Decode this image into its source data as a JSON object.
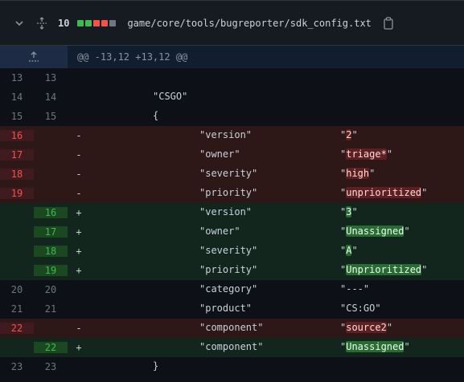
{
  "file": {
    "changes": "10",
    "path": "game/core/tools/bugreporter/sdk_config.txt",
    "diffstat_colors": [
      "#3fb950",
      "#3fb950",
      "#f85149",
      "#f85149",
      "#6e7681"
    ]
  },
  "hunk": {
    "header": "@@ -13,12 +13,12 @@"
  },
  "lines": [
    {
      "type": "ctx",
      "old": "13",
      "new": "13",
      "marker": "",
      "key": "",
      "val": "",
      "plain": ""
    },
    {
      "type": "ctx",
      "old": "14",
      "new": "14",
      "marker": "",
      "key": "",
      "val": "",
      "plain": "\"CSGO\""
    },
    {
      "type": "ctx",
      "old": "15",
      "new": "15",
      "marker": "",
      "key": "",
      "val": "",
      "plain": "{"
    },
    {
      "type": "del",
      "old": "16",
      "new": "",
      "marker": "-",
      "key": "\"version\"",
      "val": "\"2\""
    },
    {
      "type": "del",
      "old": "17",
      "new": "",
      "marker": "-",
      "key": "\"owner\"",
      "val": "\"triage*\""
    },
    {
      "type": "del",
      "old": "18",
      "new": "",
      "marker": "-",
      "key": "\"severity\"",
      "val": "\"high\""
    },
    {
      "type": "del",
      "old": "19",
      "new": "",
      "marker": "-",
      "key": "\"priority\"",
      "val": "\"unprioritized\""
    },
    {
      "type": "add",
      "old": "",
      "new": "16",
      "marker": "+",
      "key": "\"version\"",
      "val": "\"3\""
    },
    {
      "type": "add",
      "old": "",
      "new": "17",
      "marker": "+",
      "key": "\"owner\"",
      "val": "\"Unassigned\""
    },
    {
      "type": "add",
      "old": "",
      "new": "18",
      "marker": "+",
      "key": "\"severity\"",
      "val": "\"A\""
    },
    {
      "type": "add",
      "old": "",
      "new": "19",
      "marker": "+",
      "key": "\"priority\"",
      "val": "\"Unprioritized\""
    },
    {
      "type": "ctx",
      "old": "20",
      "new": "20",
      "marker": "",
      "key": "\"category\"",
      "val": "\"---\""
    },
    {
      "type": "ctx",
      "old": "21",
      "new": "21",
      "marker": "",
      "key": "\"product\"",
      "val": "\"CS:GO\""
    },
    {
      "type": "del",
      "old": "22",
      "new": "",
      "marker": "-",
      "key": "\"component\"",
      "val": "\"source2\""
    },
    {
      "type": "add",
      "old": "",
      "new": "22",
      "marker": "+",
      "key": "\"component\"",
      "val": "\"Unassigned\""
    },
    {
      "type": "ctx",
      "old": "23",
      "new": "23",
      "marker": "",
      "key": "",
      "val": "",
      "plain": "}"
    }
  ],
  "colors": {
    "del_bg": "#2d1717",
    "add_bg": "#12261e",
    "del_num": "#f85149",
    "add_num": "#3fb950"
  }
}
